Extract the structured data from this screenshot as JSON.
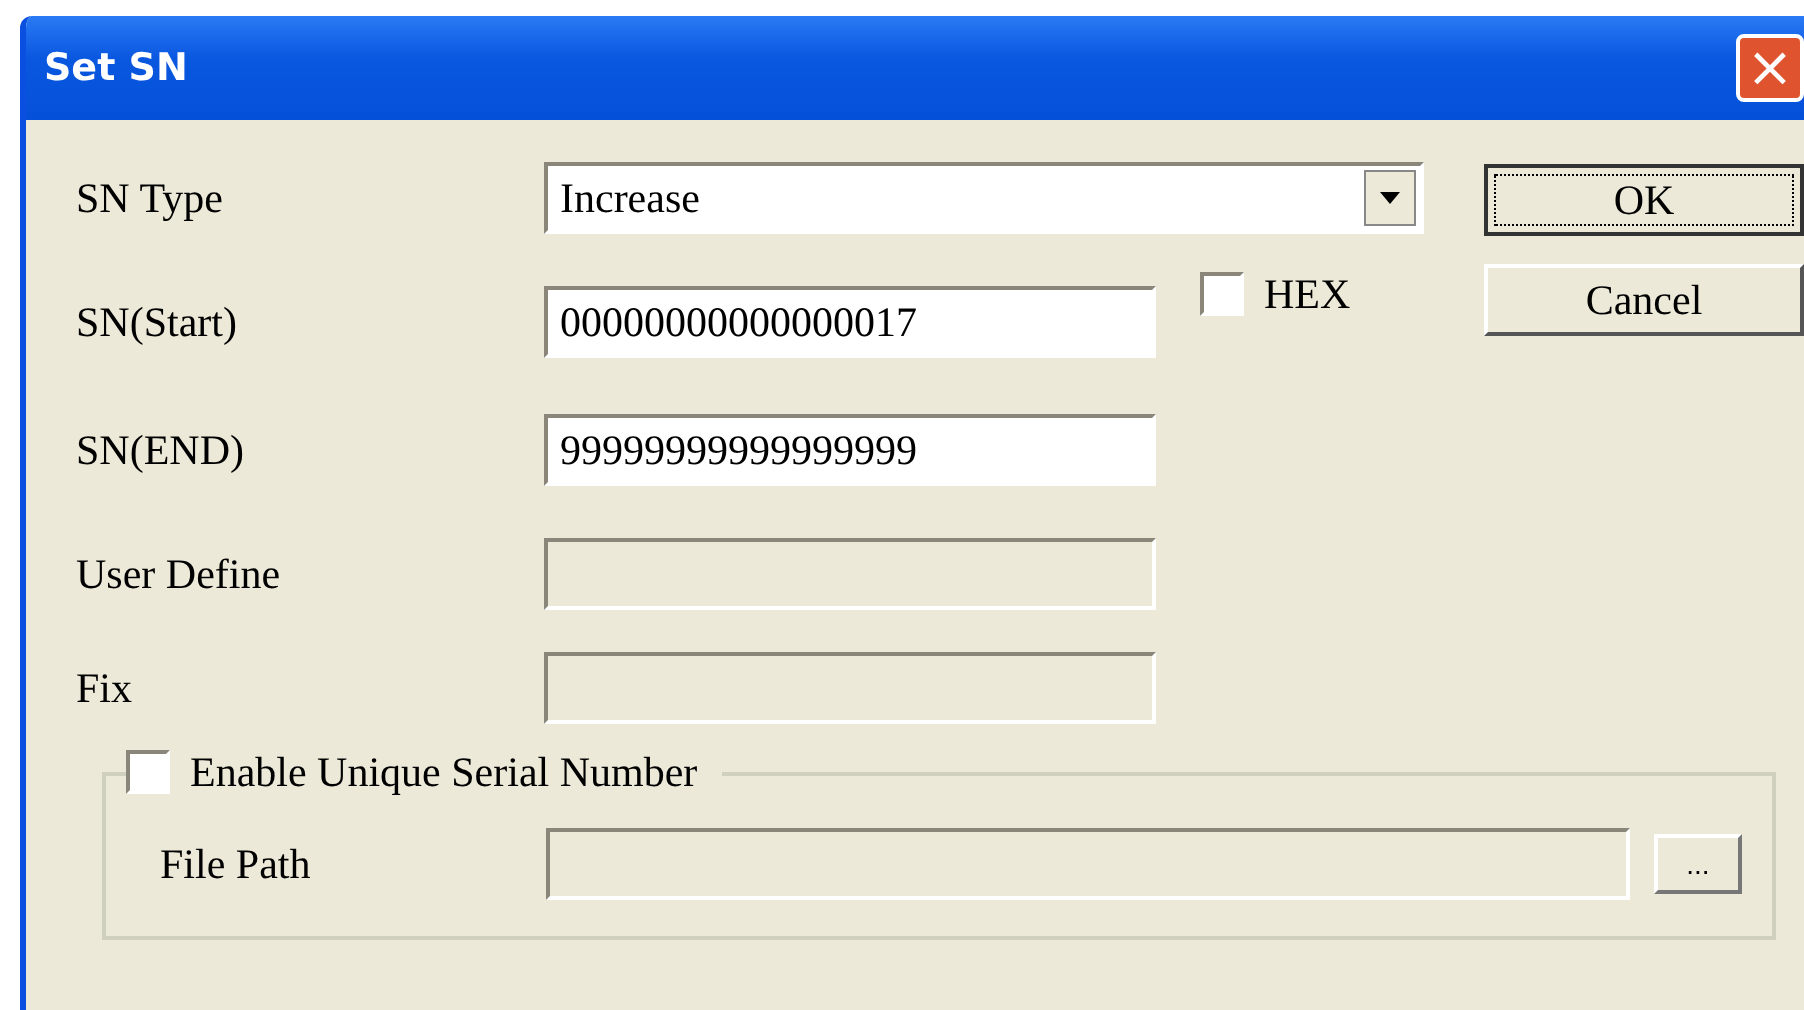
{
  "window": {
    "title": "Set SN",
    "close": "×"
  },
  "fields": [
    {
      "label": "SN Type",
      "kind": "select",
      "value": "Increase",
      "disabled": false
    },
    {
      "label": "SN(Start)",
      "kind": "text",
      "value": "00000000000000017",
      "disabled": false,
      "option": {
        "label": "HEX",
        "checked": false
      }
    },
    {
      "label": "SN(END)",
      "kind": "text",
      "value": "99999999999999999",
      "disabled": false
    },
    {
      "label": "User Define",
      "kind": "text",
      "disabled": true
    },
    {
      "label": "Fix",
      "kind": "text",
      "disabled": true
    }
  ],
  "buttons": [
    {
      "label": "OK",
      "focused": true
    },
    {
      "label": "Cancel",
      "focused": false
    }
  ],
  "group": {
    "label": "Enable Unique Serial Number",
    "checked": false,
    "path_label": "File Path",
    "browse": "..."
  }
}
